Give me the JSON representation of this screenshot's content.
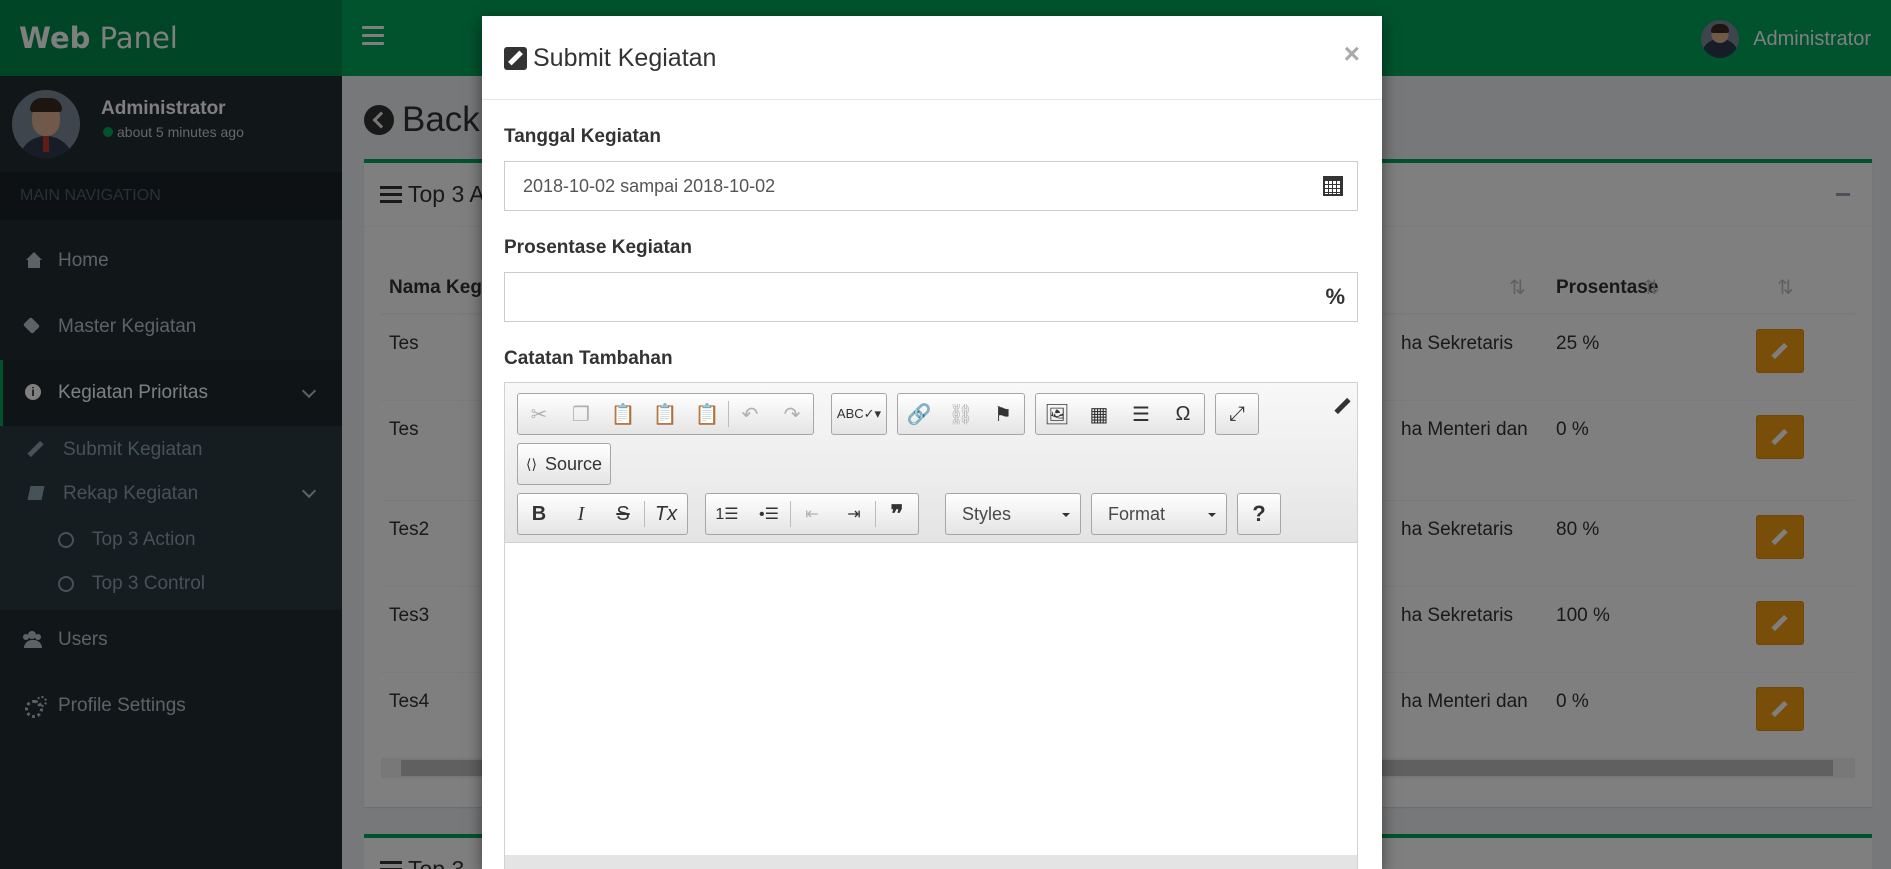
{
  "header": {
    "logo_bold": "Web",
    "logo_rest": "Panel",
    "user_name": "Administrator"
  },
  "sidebar": {
    "user_name": "Administrator",
    "user_status": "about 5 minutes ago",
    "nav_header": "MAIN NAVIGATION",
    "items": [
      {
        "label": "Home",
        "icon": "home-icon"
      },
      {
        "label": "Master Kegiatan",
        "icon": "tags-icon"
      },
      {
        "label": "Kegiatan Prioritas",
        "icon": "info-icon"
      },
      {
        "label": "Users",
        "icon": "users-icon"
      },
      {
        "label": "Profile Settings",
        "icon": "cogs-icon"
      }
    ],
    "sub_items": [
      {
        "label": "Submit Kegiatan",
        "icon": "pencil-icon"
      },
      {
        "label": "Rekap Kegiatan",
        "icon": "book-icon"
      }
    ],
    "sub_sub_items": [
      {
        "label": "Top 3 Action"
      },
      {
        "label": "Top 3 Control"
      }
    ]
  },
  "content": {
    "title": "Back",
    "box_title": "Top 3 A",
    "box2_title": "Top 3",
    "table": {
      "headers": [
        "Nama Keg",
        "",
        "Prosentase",
        ""
      ],
      "rows": [
        {
          "nama": "Tes",
          "unit": "ha Sekretaris",
          "prosentase": "25 %"
        },
        {
          "nama": "Tes",
          "unit": "ha Menteri dan",
          "prosentase": "0 %"
        },
        {
          "nama": "Tes2",
          "unit": "ha Sekretaris",
          "prosentase": "80 %"
        },
        {
          "nama": "Tes3",
          "unit": "ha Sekretaris",
          "prosentase": "100 %"
        },
        {
          "nama": "Tes4",
          "unit": "ha Menteri dan",
          "prosentase": "0 %"
        }
      ]
    }
  },
  "modal": {
    "title": "Submit Kegiatan",
    "close": "×",
    "fields": {
      "tanggal_label": "Tanggal Kegiatan",
      "tanggal_value": "2018-10-02 sampai 2018-10-02",
      "prosentase_label": "Prosentase Kegiatan",
      "prosentase_value": "",
      "prosentase_addon": "%",
      "catatan_label": "Catatan Tambahan"
    },
    "editor": {
      "source_label": "Source",
      "styles_label": "Styles",
      "format_label": "Format",
      "help_label": "?"
    }
  }
}
